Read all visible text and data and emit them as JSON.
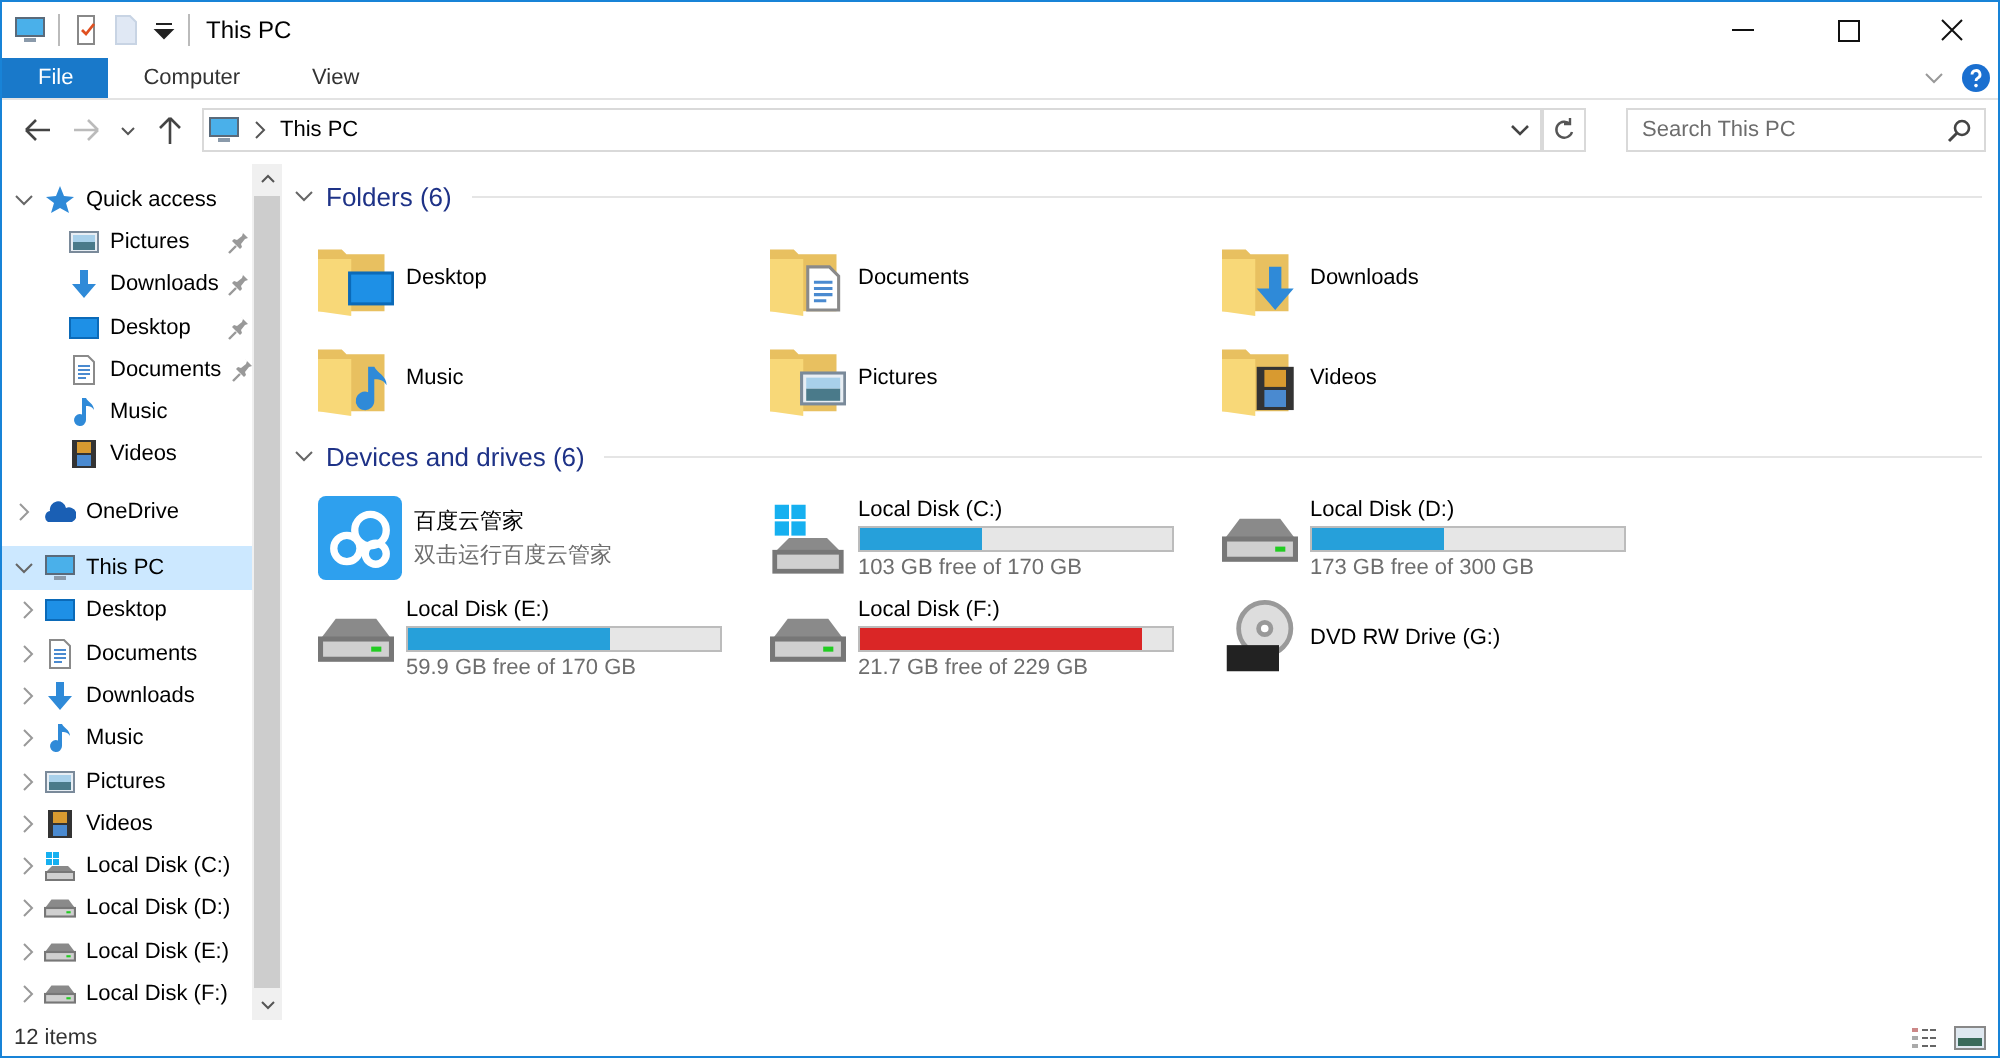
{
  "window": {
    "title": "This PC"
  },
  "ribbon": {
    "tabs": [
      {
        "label": "File",
        "selected": true
      },
      {
        "label": "Computer",
        "selected": false
      },
      {
        "label": "View",
        "selected": false
      }
    ]
  },
  "address": {
    "path": "This PC",
    "search_placeholder": "Search This PC"
  },
  "sidebar": {
    "items": [
      {
        "label": "Quick access",
        "kind": "star",
        "expanded": true,
        "selected": false,
        "children": [
          {
            "label": "Pictures",
            "kind": "pictures",
            "pinned": true
          },
          {
            "label": "Downloads",
            "kind": "downloads",
            "pinned": true
          },
          {
            "label": "Desktop",
            "kind": "desktop",
            "pinned": true
          },
          {
            "label": "Documents",
            "kind": "documents",
            "pinned": true
          },
          {
            "label": "Music",
            "kind": "music",
            "pinned": false
          },
          {
            "label": "Videos",
            "kind": "videos",
            "pinned": false
          }
        ]
      },
      {
        "label": "OneDrive",
        "kind": "cloud",
        "expanded": false,
        "selected": false
      },
      {
        "label": "This PC",
        "kind": "pc",
        "expanded": true,
        "selected": true,
        "children": [
          {
            "label": "Desktop",
            "kind": "desktop",
            "expanded": false
          },
          {
            "label": "Documents",
            "kind": "documents",
            "expanded": false
          },
          {
            "label": "Downloads",
            "kind": "downloads",
            "expanded": false
          },
          {
            "label": "Music",
            "kind": "music",
            "expanded": false
          },
          {
            "label": "Pictures",
            "kind": "pictures",
            "expanded": false
          },
          {
            "label": "Videos",
            "kind": "videos",
            "expanded": false
          },
          {
            "label": "Local Disk (C:)",
            "kind": "windows-drive",
            "expanded": false
          },
          {
            "label": "Local Disk (D:)",
            "kind": "drive",
            "expanded": false
          },
          {
            "label": "Local Disk (E:)",
            "kind": "drive",
            "expanded": false
          },
          {
            "label": "Local Disk (F:)",
            "kind": "drive",
            "expanded": false
          }
        ]
      }
    ]
  },
  "groups": [
    {
      "title": "Folders (6)",
      "expanded": true,
      "items": [
        {
          "label": "Desktop",
          "kind": "desktop"
        },
        {
          "label": "Documents",
          "kind": "documents"
        },
        {
          "label": "Downloads",
          "kind": "downloads"
        },
        {
          "label": "Music",
          "kind": "music"
        },
        {
          "label": "Pictures",
          "kind": "pictures"
        },
        {
          "label": "Videos",
          "kind": "videos"
        }
      ]
    },
    {
      "title": "Devices and drives (6)",
      "expanded": true,
      "items": [
        {
          "label": "百度云管家",
          "kind": "app",
          "subtitle": "双击运行百度云管家"
        },
        {
          "label": "Local Disk (C:)",
          "kind": "windows-drive",
          "level": 0.39,
          "color": "#26a0da",
          "free": "103 GB free of 170 GB"
        },
        {
          "label": "Local Disk (D:)",
          "kind": "drive",
          "level": 0.42,
          "color": "#26a0da",
          "free": "173 GB free of 300 GB"
        },
        {
          "label": "Local Disk (E:)",
          "kind": "drive",
          "level": 0.65,
          "color": "#26a0da",
          "free": "59.9 GB free of 170 GB"
        },
        {
          "label": "Local Disk (F:)",
          "kind": "drive",
          "level": 0.905,
          "color": "#da2626",
          "free": "21.7 GB free of 229 GB"
        },
        {
          "label": "DVD RW Drive (G:)",
          "kind": "dvd"
        }
      ]
    }
  ],
  "status_bar": {
    "count": "12 items"
  }
}
